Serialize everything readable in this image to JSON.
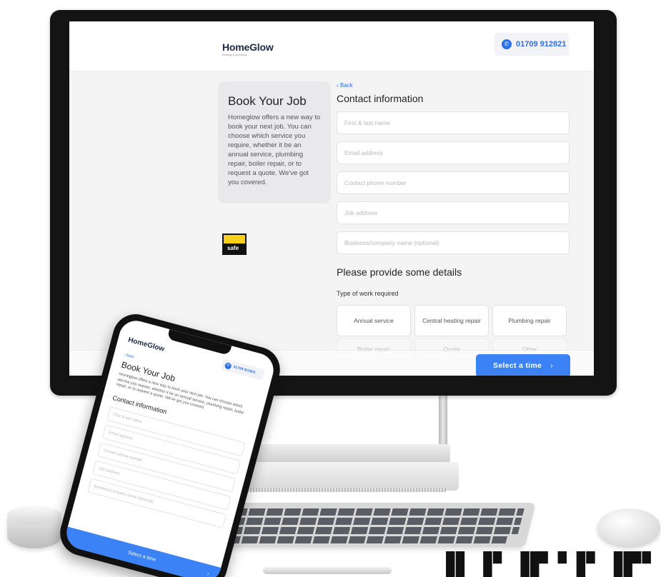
{
  "desktop": {
    "header": {
      "logo": "HomeGlow",
      "phone_number": "01709 912821"
    },
    "intro": {
      "title": "Book Your Job",
      "description": "Homeglow offers a new way to book your next job. You can choose which service you require, whether it be an annual service, plumbing repair, boiler repair, or to request a quote. We've got you covered."
    },
    "badge": {
      "label": "safe"
    },
    "form": {
      "back_label": "Back",
      "contact_title": "Contact information",
      "fields": [
        {
          "placeholder": "First & last name"
        },
        {
          "placeholder": "Email address"
        },
        {
          "placeholder": "Contact phone number"
        },
        {
          "placeholder": "Job address"
        },
        {
          "placeholder": "Business/company name (optional)"
        }
      ],
      "details_title": "Please provide some details",
      "type_of_work_label": "Type of work required",
      "work_types": [
        "Annual service",
        "Central heating repair",
        "Plumbing repair"
      ],
      "work_types_faded": [
        "Boiler repair",
        "Quote",
        "Other"
      ],
      "select_time_label": "Select a time",
      "select_time_chevron": "›"
    }
  },
  "mobile": {
    "logo": "HomeGlow",
    "phone_number": "01709 912821",
    "back_label": "Back",
    "title": "Book Your Job",
    "description": "Homeglow offers a new way to book your next job. You can choose which service you require, whether it be an annual service, plumbing repair, boiler repair, or to request a quote. We've got you covered.",
    "contact_title": "Contact information",
    "fields": [
      "First & last name",
      "Email address",
      "Contact phone number",
      "Job address",
      "Business/company name (optional)"
    ],
    "select_time_label": "Select a time"
  },
  "icons": {
    "phone": "phone-icon",
    "back": "chevron-left-icon",
    "next": "chevron-right-icon"
  },
  "colors": {
    "accent": "#3b82f6",
    "link": "#2c6fe6",
    "gas_safe_yellow": "#f7d117"
  }
}
